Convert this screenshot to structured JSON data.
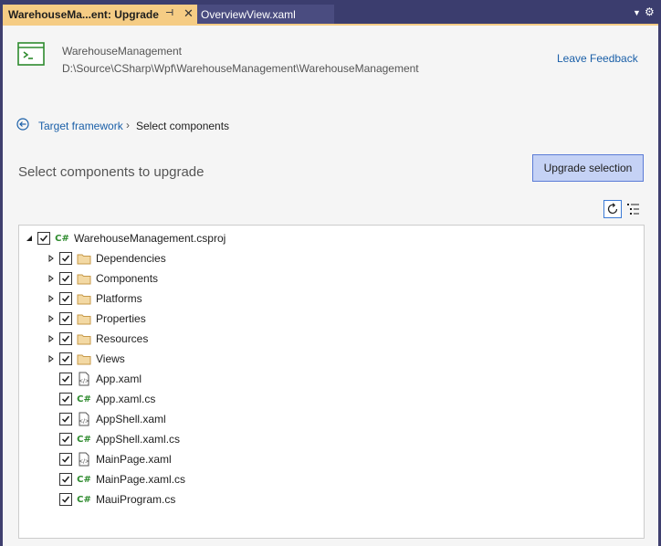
{
  "tabs": [
    {
      "label": "WarehouseMa...ent: Upgrade",
      "active": true
    },
    {
      "label": "OverviewView.xaml",
      "active": false
    }
  ],
  "header": {
    "project_name": "WarehouseManagement",
    "project_path": "D:\\Source\\CSharp\\Wpf\\WarehouseManagement\\WarehouseManagement",
    "feedback_label": "Leave Feedback"
  },
  "breadcrumb": {
    "link_label": "Target framework",
    "separator": "›",
    "current_label": "Select components"
  },
  "main": {
    "title": "Select components to upgrade",
    "upgrade_button_label": "Upgrade selection"
  },
  "tree": {
    "root": {
      "label": "WarehouseManagement.csproj",
      "icon": "csproj-icon",
      "checked": true,
      "expanded": true
    },
    "items": [
      {
        "label": "Dependencies",
        "icon": "folder-icon",
        "expandable": true,
        "checked": true
      },
      {
        "label": "Components",
        "icon": "folder-icon",
        "expandable": true,
        "checked": true
      },
      {
        "label": "Platforms",
        "icon": "folder-icon",
        "expandable": true,
        "checked": true
      },
      {
        "label": "Properties",
        "icon": "folder-icon",
        "expandable": true,
        "checked": true
      },
      {
        "label": "Resources",
        "icon": "folder-icon",
        "expandable": true,
        "checked": true
      },
      {
        "label": "Views",
        "icon": "folder-icon",
        "expandable": true,
        "checked": true
      },
      {
        "label": "App.xaml",
        "icon": "xaml-file-icon",
        "expandable": false,
        "checked": true
      },
      {
        "label": "App.xaml.cs",
        "icon": "csharp-file-icon",
        "expandable": false,
        "checked": true
      },
      {
        "label": "AppShell.xaml",
        "icon": "xaml-file-icon",
        "expandable": false,
        "checked": true
      },
      {
        "label": "AppShell.xaml.cs",
        "icon": "csharp-file-icon",
        "expandable": false,
        "checked": true
      },
      {
        "label": "MainPage.xaml",
        "icon": "xaml-file-icon",
        "expandable": false,
        "checked": true
      },
      {
        "label": "MainPage.xaml.cs",
        "icon": "csharp-file-icon",
        "expandable": false,
        "checked": true
      },
      {
        "label": "MauiProgram.cs",
        "icon": "csharp-file-icon",
        "expandable": false,
        "checked": true
      }
    ]
  },
  "colors": {
    "accent": "#1a5fa8",
    "active_tab": "#f5cc84",
    "tab_bar": "#3b3d6e",
    "button_bg": "#c5d2f5",
    "csharp_green": "#2e8b2e",
    "folder_yellow": "#dcb67a"
  }
}
